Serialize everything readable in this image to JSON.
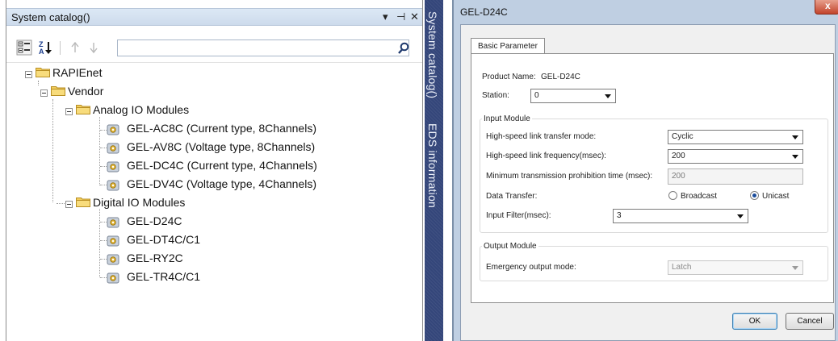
{
  "catalog": {
    "title": "System catalog()",
    "controls": {
      "dropdown": "▾",
      "pin": "⊣",
      "close": "✕"
    },
    "search": {
      "value": "",
      "placeholder": ""
    },
    "tree": {
      "root": "RAPIEnet",
      "vendor": "Vendor",
      "analog_folder": "Analog IO Modules",
      "analog_items": [
        "GEL-AC8C (Current type, 8Channels)",
        "GEL-AV8C (Voltage type, 8Channels)",
        "GEL-DC4C (Current type, 4Channels)",
        "GEL-DV4C (Voltage type, 4Channels)"
      ],
      "digital_folder": "Digital IO Modules",
      "digital_items": [
        "GEL-D24C",
        "GEL-DT4C/C1",
        "GEL-RY2C",
        "GEL-TR4C/C1"
      ]
    }
  },
  "side_tabs": {
    "catalog": "System catalog()",
    "eds": "EDS information"
  },
  "dialog": {
    "title": "GEL-D24C",
    "close_label": "x",
    "tab_label": "Basic Parameter",
    "product_name_label": "Product Name:",
    "product_name_value": "GEL-D24C",
    "station_label": "Station:",
    "station_value": "0",
    "input_module": {
      "title": "Input Module",
      "hs_mode_label": "High-speed link transfer mode:",
      "hs_mode_value": "Cyclic",
      "hs_freq_label": "High-speed link frequency(msec):",
      "hs_freq_value": "200",
      "min_tx_label": "Minimum transmission prohibition time (msec):",
      "min_tx_value": "200",
      "data_transfer_label": "Data Transfer:",
      "broadcast_label": "Broadcast",
      "unicast_label": "Unicast",
      "selected_transfer": "Unicast",
      "input_filter_label": "Input Filter(msec):",
      "input_filter_value": "3"
    },
    "output_module": {
      "title": "Output Module",
      "emergency_label": "Emergency output mode:",
      "emergency_value": "Latch"
    },
    "ok_label": "OK",
    "cancel_label": "Cancel"
  }
}
